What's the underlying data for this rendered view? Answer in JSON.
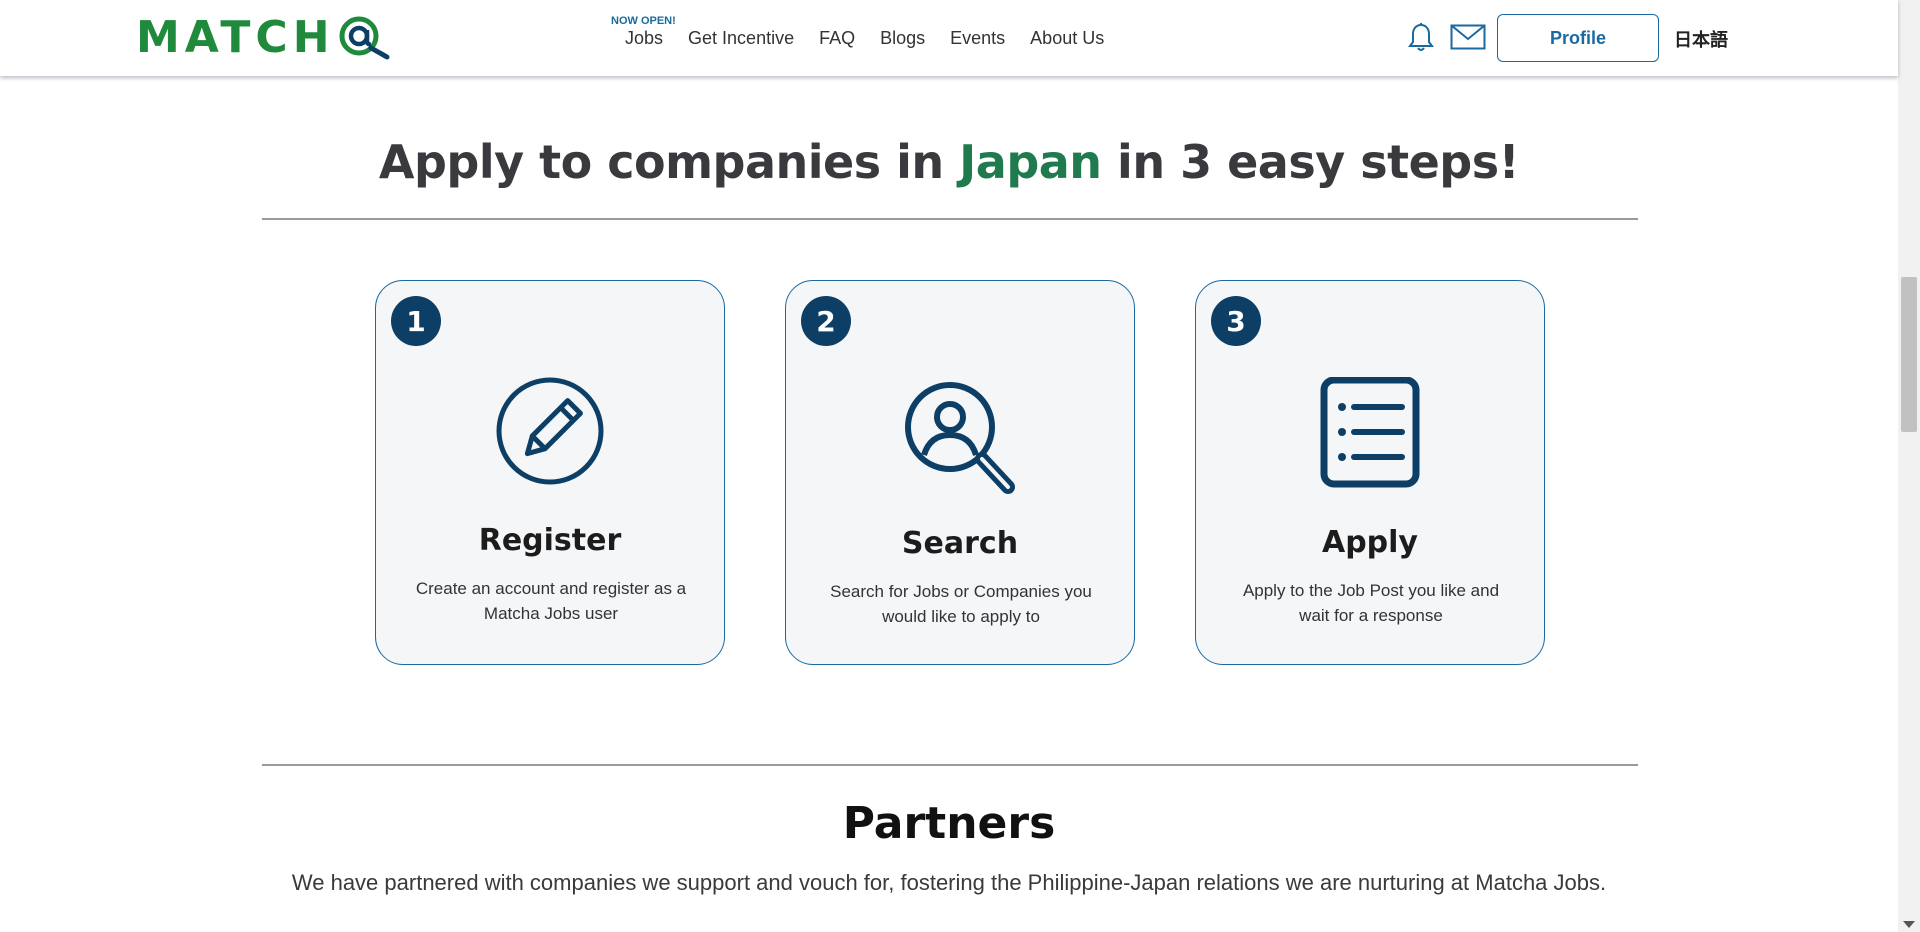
{
  "header": {
    "logo_text": "MATCH",
    "nav": [
      {
        "label": "Jobs",
        "badge": "NOW OPEN!"
      },
      {
        "label": "Get Incentive"
      },
      {
        "label": "FAQ"
      },
      {
        "label": "Blogs"
      },
      {
        "label": "Events"
      },
      {
        "label": "About Us"
      }
    ],
    "icons": [
      "bell-icon",
      "mail-icon"
    ],
    "profile_label": "Profile",
    "language_label": "日本語"
  },
  "colors": {
    "brand_green": "#1f8a3c",
    "highlight_green": "#1f7a4d",
    "brand_blue": "#1a6aa0",
    "navy": "#0d3f66",
    "card_bg": "#f4f6f8"
  },
  "steps_section": {
    "title_before": "Apply to companies in ",
    "title_highlight": "Japan",
    "title_after": " in 3 easy steps!",
    "steps": [
      {
        "number": "1",
        "icon": "pencil-circle-icon",
        "title": "Register",
        "description": "Create an account and register as a Matcha Jobs user"
      },
      {
        "number": "2",
        "icon": "person-search-icon",
        "title": "Search",
        "description": "Search for Jobs or Companies you would like to apply to"
      },
      {
        "number": "3",
        "icon": "list-document-icon",
        "title": "Apply",
        "description": "Apply to the Job Post you like and wait for a response"
      }
    ]
  },
  "partners_section": {
    "title": "Partners",
    "description": "We have partnered with companies we support and vouch for, fostering the Philippine-Japan relations we are nurturing at Matcha Jobs."
  }
}
